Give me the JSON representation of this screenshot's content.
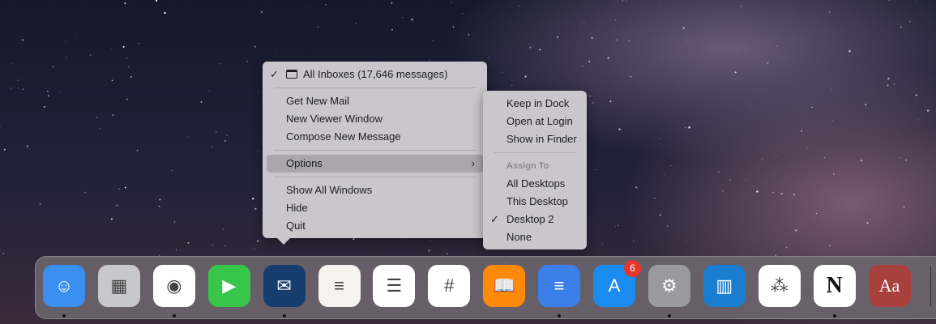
{
  "mail_menu": {
    "inbox": "All Inboxes (17,646 messages)",
    "items1": [
      "Get New Mail",
      "New Viewer Window",
      "Compose New Message"
    ],
    "options": "Options",
    "options_arrow": "›",
    "items2": [
      "Show All Windows",
      "Hide",
      "Quit"
    ],
    "check": "✓"
  },
  "options_menu": {
    "items1": [
      "Keep in Dock",
      "Open at Login",
      "Show in Finder"
    ],
    "header": "Assign To",
    "items2": [
      "All Desktops",
      "This Desktop",
      "Desktop 2",
      "None"
    ],
    "checked": "Desktop 2",
    "check": "✓"
  },
  "dock": {
    "apps": [
      {
        "name": "Finder",
        "glyph": "☺",
        "bg": "#3a8ff0",
        "running": true
      },
      {
        "name": "Launchpad",
        "glyph": "▦",
        "bg": "#c8c8cc",
        "running": false
      },
      {
        "name": "Google Chrome",
        "glyph": "◉",
        "bg": "#ffffff",
        "running": true
      },
      {
        "name": "FaceTime",
        "glyph": "▶",
        "bg": "#38c64a",
        "running": false
      },
      {
        "name": "Mail",
        "glyph": "✉",
        "bg": "#173d6e",
        "running": true
      },
      {
        "name": "Notes",
        "glyph": "≡",
        "bg": "#f5f3ee",
        "running": false
      },
      {
        "name": "Reminders",
        "glyph": "☰",
        "bg": "#ffffff",
        "running": false
      },
      {
        "name": "Slack",
        "glyph": "#",
        "bg": "#ffffff",
        "running": false
      },
      {
        "name": "Books",
        "glyph": "📖",
        "bg": "#ff8a0a",
        "running": false
      },
      {
        "name": "Google Docs",
        "glyph": "≡",
        "bg": "#3c7fe8",
        "running": true
      },
      {
        "name": "App Store",
        "glyph": "A",
        "bg": "#1a8cf0",
        "running": false
      },
      {
        "name": "System Preferences",
        "glyph": "⚙",
        "bg": "#9a9a9e",
        "running": true
      },
      {
        "name": "Trello",
        "glyph": "▥",
        "bg": "#1a7ed0",
        "running": false
      },
      {
        "name": "Asana",
        "glyph": "⁂",
        "bg": "#ffffff",
        "running": false
      },
      {
        "name": "Notion",
        "glyph": "N",
        "bg": "#ffffff",
        "running": true
      },
      {
        "name": "Dictionary",
        "glyph": "Aa",
        "bg": "#a8403e",
        "running": false
      }
    ],
    "app_store_badge": "6"
  }
}
